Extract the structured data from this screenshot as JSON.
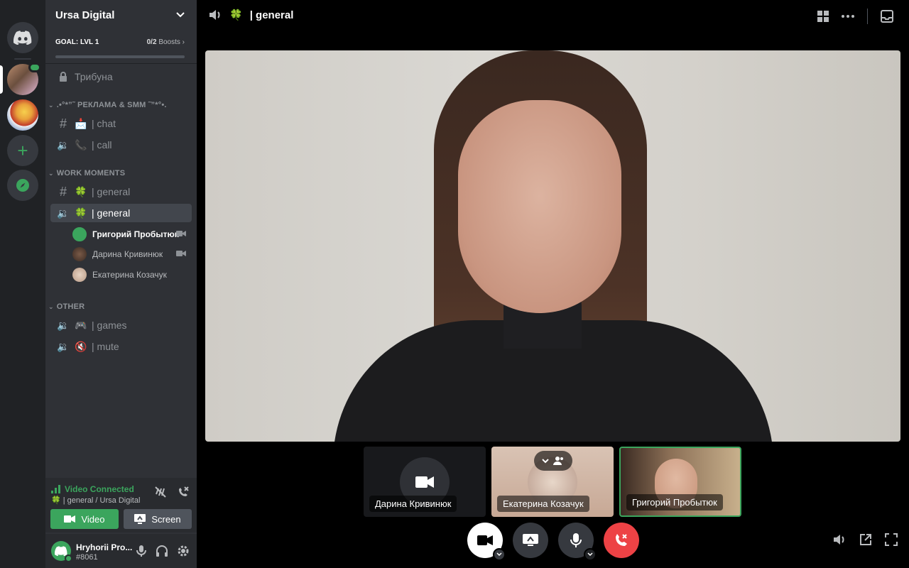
{
  "server": {
    "name": "Ursa Digital",
    "boost_goal": "GOAL: LVL 1",
    "boost_count": "0/2",
    "boost_label": "Boosts"
  },
  "channels": {
    "tribune": "Трибуна",
    "cat1": ".•°*”˜ РЕКЛАМА & SMM ˜”*°•.",
    "chat": "| chat",
    "call": "| call",
    "cat2": "WORK MOMENTS",
    "general_text": "| general",
    "general_voice": "| general",
    "voice_users": [
      "Григорий Пробытюк",
      "Дарина Кривинюк",
      "Екатерина Козачук"
    ],
    "cat3": "OTHER",
    "games": "| games",
    "mute": "| mute"
  },
  "voice_panel": {
    "status": "Video Connected",
    "sub": "| general / Ursa Digital",
    "video_label": "Video",
    "screen_label": "Screen"
  },
  "user": {
    "name": "Hryhorii Pro...",
    "tag": "#8061"
  },
  "main": {
    "channel_title": "| general"
  },
  "tiles": [
    {
      "name": "Дарина Кривинюк"
    },
    {
      "name": "Екатерина Козачук"
    },
    {
      "name": "Григорий Пробытюк"
    }
  ],
  "colors": {
    "accent_green": "#3ba55d",
    "danger_red": "#ed4245",
    "sidebar_bg": "#2f3136",
    "rail_bg": "#202225"
  }
}
